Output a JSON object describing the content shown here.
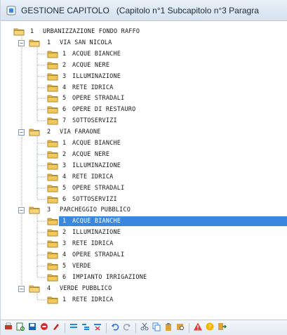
{
  "window": {
    "title": "GESTIONE CAPITOLO",
    "subtitle": "(Capitolo n°1 Subcapitolo n°3 Paragra"
  },
  "tree": {
    "rows": [
      {
        "level": 0,
        "expander": "",
        "num": "1",
        "label": "URBANIZZAZIONE FONDO RAFFO",
        "selected": false
      },
      {
        "level": 1,
        "expander": "−",
        "num": "1",
        "label": "VIA SAN NICOLA",
        "selected": false
      },
      {
        "level": 2,
        "expander": "",
        "num": "1",
        "label": "ACQUE BIANCHE",
        "selected": false
      },
      {
        "level": 2,
        "expander": "",
        "num": "2",
        "label": "ACQUE NERE",
        "selected": false
      },
      {
        "level": 2,
        "expander": "",
        "num": "3",
        "label": "ILLUMINAZIONE",
        "selected": false
      },
      {
        "level": 2,
        "expander": "",
        "num": "4",
        "label": "RETE IDRICA",
        "selected": false
      },
      {
        "level": 2,
        "expander": "",
        "num": "5",
        "label": "OPERE STRADALI",
        "selected": false
      },
      {
        "level": 2,
        "expander": "",
        "num": "6",
        "label": "OPERE DI RESTAURO",
        "selected": false
      },
      {
        "level": 2,
        "expander": "",
        "num": "7",
        "label": "SOTTOSERVIZI",
        "selected": false
      },
      {
        "level": 1,
        "expander": "−",
        "num": "2",
        "label": "VIA FARAONE",
        "selected": false
      },
      {
        "level": 2,
        "expander": "",
        "num": "1",
        "label": "ACQUE BIANCHE",
        "selected": false
      },
      {
        "level": 2,
        "expander": "",
        "num": "2",
        "label": "ACQUE NERE",
        "selected": false
      },
      {
        "level": 2,
        "expander": "",
        "num": "3",
        "label": "ILLUMINAZIONE",
        "selected": false
      },
      {
        "level": 2,
        "expander": "",
        "num": "4",
        "label": "RETE IDRICA",
        "selected": false
      },
      {
        "level": 2,
        "expander": "",
        "num": "5",
        "label": "OPERE STRADALI",
        "selected": false
      },
      {
        "level": 2,
        "expander": "",
        "num": "6",
        "label": "SOTTOSERVIZI",
        "selected": false
      },
      {
        "level": 1,
        "expander": "−",
        "num": "3",
        "label": "PARCHEGGIO PUBBLICO",
        "selected": false
      },
      {
        "level": 2,
        "expander": "",
        "num": "1",
        "label": "ACQUE BIANCHE",
        "selected": true
      },
      {
        "level": 2,
        "expander": "",
        "num": "2",
        "label": "ILLUMINAZIONE",
        "selected": false
      },
      {
        "level": 2,
        "expander": "",
        "num": "3",
        "label": "RETE IDRICA",
        "selected": false
      },
      {
        "level": 2,
        "expander": "",
        "num": "4",
        "label": "OPERE STRADALI",
        "selected": false
      },
      {
        "level": 2,
        "expander": "",
        "num": "5",
        "label": "VERDE",
        "selected": false
      },
      {
        "level": 2,
        "expander": "",
        "num": "6",
        "label": "IMPIANTO IRRIGAZIONE",
        "selected": false
      },
      {
        "level": 1,
        "expander": "−",
        "num": "4",
        "label": "VERDE PUBBLICO",
        "selected": false
      },
      {
        "level": 2,
        "expander": "",
        "num": "1",
        "label": "RETE IDRICA",
        "selected": false
      }
    ]
  },
  "toolbar": {
    "buttons": [
      {
        "icon": "print-icon",
        "color": "#c0392b"
      },
      {
        "icon": "print-preview-icon",
        "color": "#2e7d32"
      },
      {
        "icon": "export-icon",
        "color": "#1565c0"
      },
      {
        "icon": "stop-icon",
        "color": "#d32f2f"
      },
      {
        "icon": "edit-icon",
        "color": "#c62828"
      },
      {
        "sep": true
      },
      {
        "icon": "insert-row-icon",
        "color": "#1e88e5"
      },
      {
        "icon": "insert-child-icon",
        "color": "#1e88e5"
      },
      {
        "icon": "delete-row-icon",
        "color": "#1e88e5"
      },
      {
        "sep": true
      },
      {
        "icon": "undo-icon",
        "color": "#2a6fd6"
      },
      {
        "icon": "redo-icon",
        "color": "#9aa7b5"
      },
      {
        "sep": true
      },
      {
        "icon": "cut-icon",
        "color": "#5d6d7e"
      },
      {
        "icon": "copy-icon",
        "color": "#3a87e0"
      },
      {
        "icon": "paste-icon",
        "color": "#e0a33a"
      },
      {
        "icon": "find-icon",
        "color": "#e0a33a"
      },
      {
        "sep": true
      },
      {
        "icon": "warning-icon",
        "color": "#e53935"
      },
      {
        "icon": "help-icon",
        "color": "#f4b400"
      },
      {
        "icon": "exit-icon",
        "color": "#2e7d32"
      }
    ]
  }
}
